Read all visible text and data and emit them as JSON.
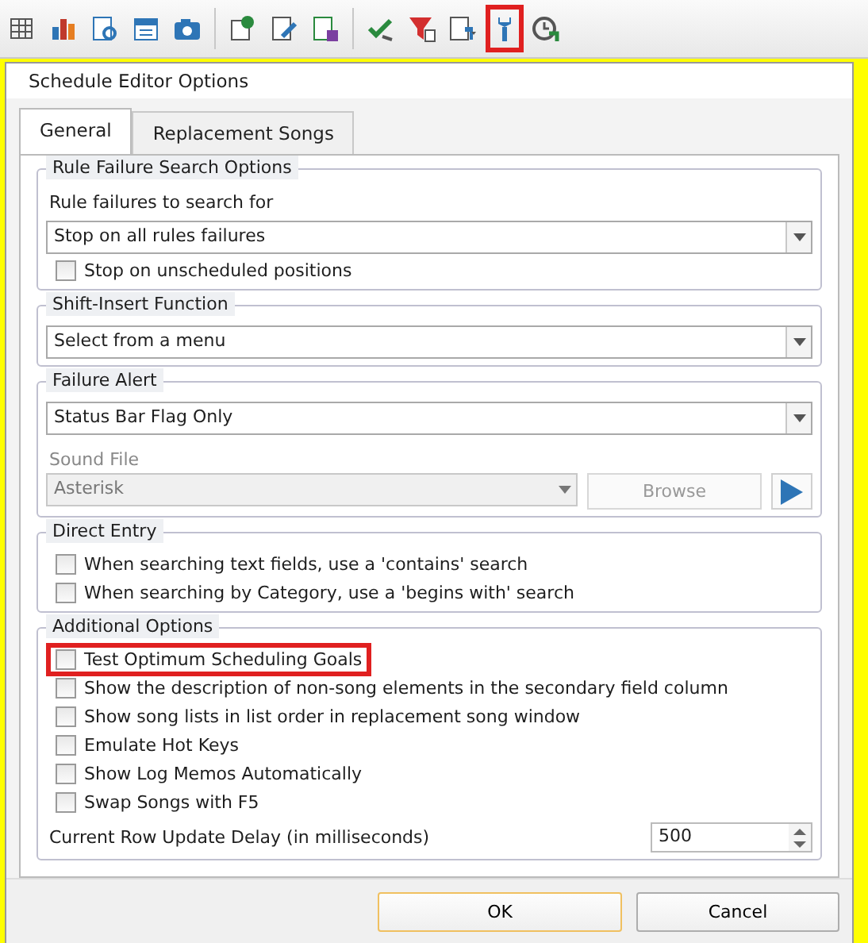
{
  "toolbar": {
    "items": [
      {
        "kind": "grid",
        "highlighted": false
      },
      {
        "kind": "bars",
        "highlighted": false
      },
      {
        "kind": "doc-search",
        "highlighted": false
      },
      {
        "kind": "calendar",
        "highlighted": false
      },
      {
        "kind": "camera",
        "highlighted": false
      },
      {
        "kind": "separator"
      },
      {
        "kind": "doc-clock",
        "highlighted": false
      },
      {
        "kind": "doc-pencil",
        "highlighted": false
      },
      {
        "kind": "doc-save",
        "highlighted": false
      },
      {
        "kind": "separator"
      },
      {
        "kind": "check",
        "highlighted": false
      },
      {
        "kind": "filter",
        "highlighted": false
      },
      {
        "kind": "doc-dropdown",
        "highlighted": false
      },
      {
        "kind": "wrench",
        "highlighted": true
      },
      {
        "kind": "clock",
        "highlighted": false
      }
    ]
  },
  "dialog": {
    "title": "Schedule Editor Options",
    "tabs": [
      {
        "label": "General",
        "selected": true
      },
      {
        "label": "Replacement Songs",
        "selected": false
      }
    ],
    "groups": [
      {
        "title": "Rule Failure Search Options",
        "rows": [
          {
            "kind": "label",
            "text": "Rule failures to search for"
          },
          {
            "kind": "dropdown",
            "value": "Stop on all rules failures"
          },
          {
            "kind": "checkbox",
            "label": "Stop on unscheduled positions",
            "checked": false,
            "highlighted": false
          }
        ]
      },
      {
        "title": "Shift-Insert Function",
        "rows": [
          {
            "kind": "dropdown",
            "value": "Select from a menu"
          }
        ]
      },
      {
        "title": "Failure Alert",
        "rows": [
          {
            "kind": "dropdown",
            "value": "Status Bar Flag Only"
          },
          {
            "kind": "sound",
            "label": "Sound File",
            "value": "Asterisk",
            "button": "Browse"
          }
        ]
      },
      {
        "title": "Direct Entry",
        "rows": [
          {
            "kind": "checkbox",
            "label": "When searching text fields, use a 'contains' search",
            "checked": false,
            "highlighted": false
          },
          {
            "kind": "checkbox",
            "label": "When searching by Category, use a 'begins with' search",
            "checked": false,
            "highlighted": false
          }
        ]
      },
      {
        "title": "Additional Options",
        "rows": [
          {
            "kind": "checkbox",
            "label": "Test Optimum Scheduling Goals",
            "checked": false,
            "highlighted": true
          },
          {
            "kind": "checkbox",
            "label": "Show the description of non-song elements in the secondary field column",
            "checked": false,
            "highlighted": false
          },
          {
            "kind": "checkbox",
            "label": "Show song lists in list order in replacement song window",
            "checked": false,
            "highlighted": false
          },
          {
            "kind": "checkbox",
            "label": "Emulate Hot Keys",
            "checked": false,
            "highlighted": false
          },
          {
            "kind": "checkbox",
            "label": "Show Log Memos Automatically",
            "checked": false,
            "highlighted": false
          },
          {
            "kind": "checkbox",
            "label": "Swap Songs with F5",
            "checked": false,
            "highlighted": false
          },
          {
            "kind": "spinner",
            "label": "Current Row Update Delay (in milliseconds)",
            "value": "500"
          }
        ]
      }
    ],
    "buttons": [
      {
        "label": "OK",
        "default": true
      },
      {
        "label": "Cancel",
        "default": false
      }
    ]
  }
}
